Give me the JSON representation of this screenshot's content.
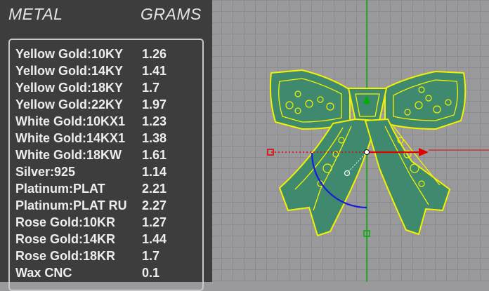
{
  "panel": {
    "header": {
      "metal_label": "METAL",
      "grams_label": "GRAMS"
    },
    "rows": [
      {
        "metal": "Yellow Gold:10KY",
        "grams": "1.26"
      },
      {
        "metal": "Yellow Gold:14KY",
        "grams": "1.41"
      },
      {
        "metal": "Yellow Gold:18KY",
        "grams": "1.7"
      },
      {
        "metal": "Yellow Gold:22KY",
        "grams": "1.97"
      },
      {
        "metal": "White Gold:10KX1",
        "grams": "1.23"
      },
      {
        "metal": "White Gold:14KX1",
        "grams": "1.38"
      },
      {
        "metal": "White Gold:18KW",
        "grams": "1.61"
      },
      {
        "metal": "Silver:925",
        "grams": "1.14"
      },
      {
        "metal": "Platinum:PLAT",
        "grams": "2.21"
      },
      {
        "metal": "Platinum:PLAT RU",
        "grams": "2.27"
      },
      {
        "metal": "Rose Gold:10KR",
        "grams": "1.27"
      },
      {
        "metal": "Rose Gold:14KR",
        "grams": "1.44"
      },
      {
        "metal": "Rose Gold:18KR",
        "grams": "1.7"
      },
      {
        "metal": "Wax  CNC",
        "grams": "0.1"
      }
    ]
  },
  "colors": {
    "panel_bg": "#3d3d3d",
    "viewport_bg": "#9a9a9d",
    "selection_yellow": "#f2f200",
    "model_fill": "#3f8a6e",
    "axis_x_red": "#e00000",
    "axis_y_green": "#00b000",
    "arc_blue": "#1a1adb"
  },
  "icons": [
    "gumball-x-arrow-icon",
    "gumball-y-arrow-icon",
    "gumball-rotate-arc-icon",
    "gumball-scale-handle-icon"
  ]
}
